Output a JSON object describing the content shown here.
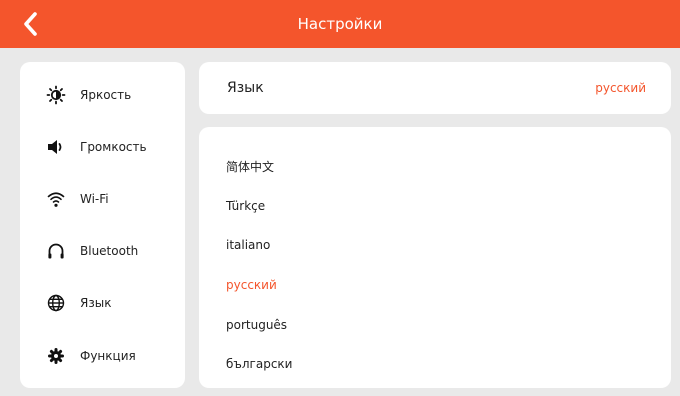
{
  "header": {
    "title": "Настройки",
    "back_icon": "chevron-left-icon"
  },
  "sidebar": {
    "items": [
      {
        "label": "Яркость",
        "icon": "brightness-icon"
      },
      {
        "label": "Громкость",
        "icon": "volume-icon"
      },
      {
        "label": "Wi-Fi",
        "icon": "wifi-icon"
      },
      {
        "label": "Bluetooth",
        "icon": "headphones-icon"
      },
      {
        "label": "Язык",
        "icon": "globe-icon"
      },
      {
        "label": "Функция",
        "icon": "gear-icon"
      }
    ]
  },
  "language": {
    "label": "Язык",
    "current": "русский",
    "options": [
      "简体中文",
      "Türkçe",
      "italiano",
      "русский",
      "português",
      "български"
    ],
    "selected_index": 3
  },
  "colors": {
    "accent": "#f4552c",
    "background": "#e9e9e9",
    "card": "#ffffff"
  }
}
